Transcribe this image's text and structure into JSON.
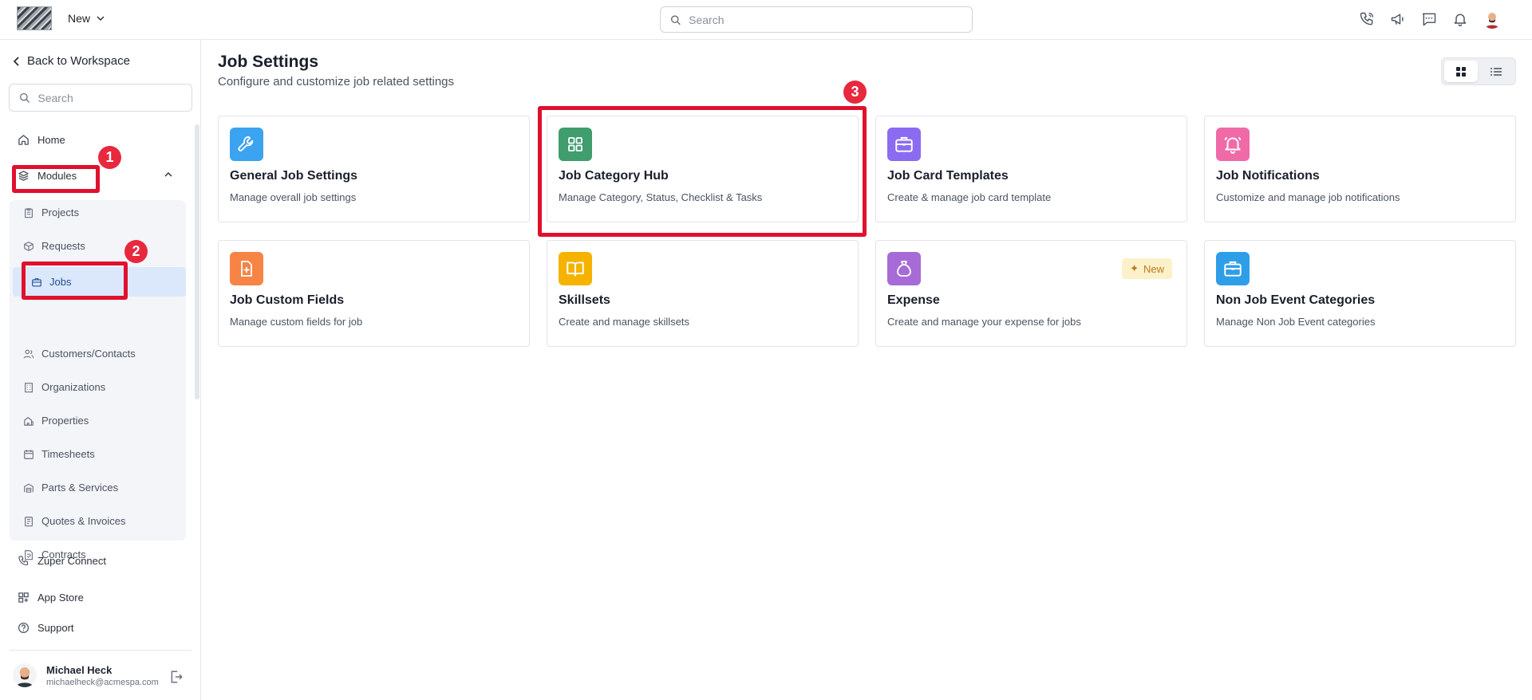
{
  "topbar": {
    "new_label": "New",
    "search_placeholder": "Search",
    "icons": [
      "phone-icon",
      "megaphone-icon",
      "chat-icon",
      "bell-icon",
      "user-avatar"
    ]
  },
  "sidebar": {
    "back_label": "Back to Workspace",
    "search_placeholder": "Search",
    "home_label": "Home",
    "modules_label": "Modules",
    "module_items": [
      {
        "label": "Projects",
        "icon": "clipboard-icon"
      },
      {
        "label": "Requests",
        "icon": "box-icon"
      },
      {
        "label": "Jobs",
        "icon": "briefcase-icon",
        "active": true
      },
      {
        "label": "Customers/Contacts",
        "icon": "users-icon"
      },
      {
        "label": "Organizations",
        "icon": "building-icon"
      },
      {
        "label": "Properties",
        "icon": "property-icon"
      },
      {
        "label": "Timesheets",
        "icon": "calendar-icon"
      },
      {
        "label": "Parts & Services",
        "icon": "warehouse-icon"
      },
      {
        "label": "Quotes & Invoices",
        "icon": "invoice-icon"
      },
      {
        "label": "Contracts",
        "icon": "contract-icon"
      }
    ],
    "bottom_items": [
      {
        "label": "Zuper Connect",
        "icon": "phone-icon"
      },
      {
        "label": "App Store",
        "icon": "apps-icon"
      },
      {
        "label": "Support",
        "icon": "help-icon"
      }
    ],
    "user": {
      "name": "Michael Heck",
      "email": "michaelheck@acmespa.com"
    }
  },
  "main": {
    "title": "Job Settings",
    "subtitle": "Configure and customize job related settings",
    "cards": [
      {
        "title": "General Job Settings",
        "desc": "Manage overall job settings",
        "icon": "wrench-icon",
        "color": "#3ba3f0"
      },
      {
        "title": "Job Category Hub",
        "desc": "Manage Category, Status, Checklist & Tasks",
        "icon": "grid-icon",
        "color": "#3f9d6e"
      },
      {
        "title": "Job Card Templates",
        "desc": "Create & manage job card template",
        "icon": "briefcase-icon",
        "color": "#8b6cf1"
      },
      {
        "title": "Job Notifications",
        "desc": "Customize and manage job notifications",
        "icon": "bell-icon",
        "color": "#f06aa8"
      },
      {
        "title": "Job Custom Fields",
        "desc": "Manage custom fields for job",
        "icon": "file-plus-icon",
        "color": "#f58445"
      },
      {
        "title": "Skillsets",
        "desc": "Create and manage skillsets",
        "icon": "book-icon",
        "color": "#f5b300"
      },
      {
        "title": "Expense",
        "desc": "Create and manage your expense for jobs",
        "icon": "money-bag-icon",
        "color": "#a66bd6",
        "badge": "New"
      },
      {
        "title": "Non Job Event Categories",
        "desc": "Manage Non Job Event categories",
        "icon": "briefcase-icon",
        "color": "#2f9ee8"
      }
    ]
  },
  "annotations": [
    "1",
    "2",
    "3"
  ],
  "colors": {
    "annotation": "#e0102e",
    "active_bg": "#dbe8fb",
    "brand_blue": "#1f4d8f"
  }
}
